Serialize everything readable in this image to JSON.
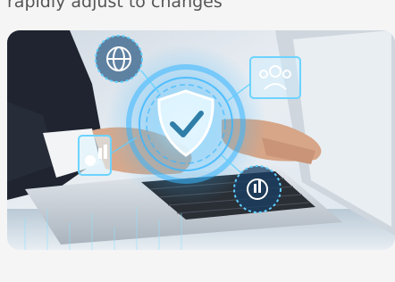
{
  "caption": "rapidly adjust to changes",
  "hero_image": {
    "alt": "Hands typing on laptop with holographic security shield and icons",
    "icons": [
      "globe-icon",
      "shield-check-icon",
      "users-icon",
      "report-icon",
      "gear-chart-icon"
    ],
    "colors": {
      "glow": "#2fb8ff",
      "glow_soft": "#8fe1ff",
      "laptop": "#cfd6de",
      "keys": "#2a2f36",
      "suit": "#1f2430",
      "shirt": "#f2f4f6"
    }
  }
}
